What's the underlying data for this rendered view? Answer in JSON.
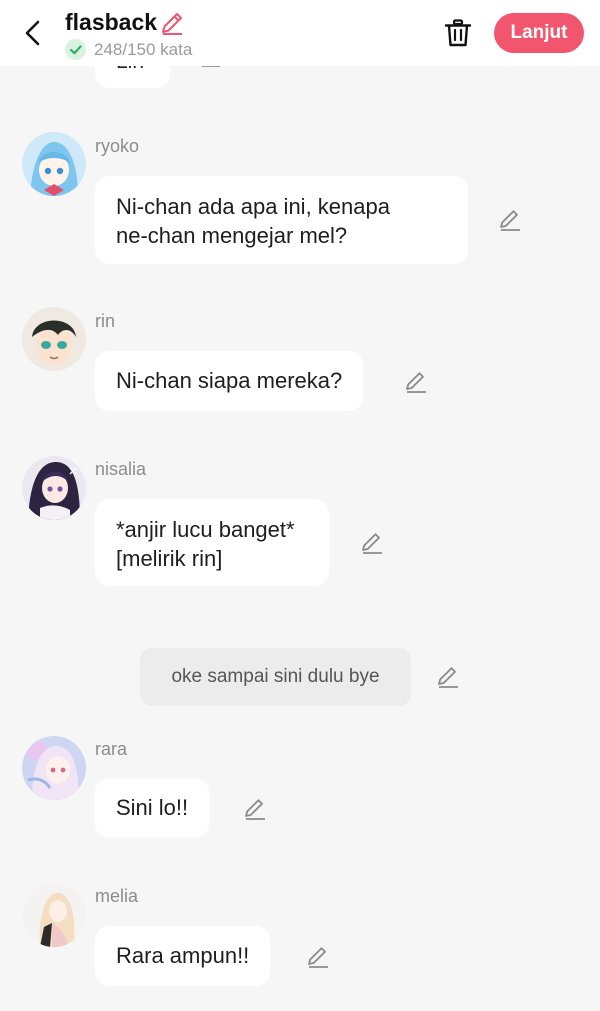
{
  "header": {
    "back_icon": "chevron-left-icon",
    "title": "flasback",
    "title_edit_icon": "pencil-icon",
    "word_count": "248/150 kata",
    "check_icon": "check-circle-icon",
    "delete_icon": "trash-icon",
    "next_label": "Lanjut",
    "accent_color": "#f2566f"
  },
  "partial_message": {
    "text": "Lin"
  },
  "messages": [
    {
      "name": "ryoko",
      "text_lines": [
        "Ni-chan ada apa ini, kenapa",
        "ne-chan mengejar mel?"
      ]
    },
    {
      "name": "rin",
      "text_lines": [
        "Ni-chan siapa mereka?"
      ]
    },
    {
      "name": "nisalia",
      "text_lines": [
        "*anjir lucu banget*",
        "[melirik rin]"
      ]
    },
    {
      "name": "rara",
      "text_lines": [
        "Sini lo!!"
      ]
    },
    {
      "name": "melia",
      "text_lines": [
        "Rara ampun!!"
      ]
    }
  ],
  "narration": {
    "text": "oke sampai sini dulu bye"
  },
  "edit_icon": "pencil-icon"
}
